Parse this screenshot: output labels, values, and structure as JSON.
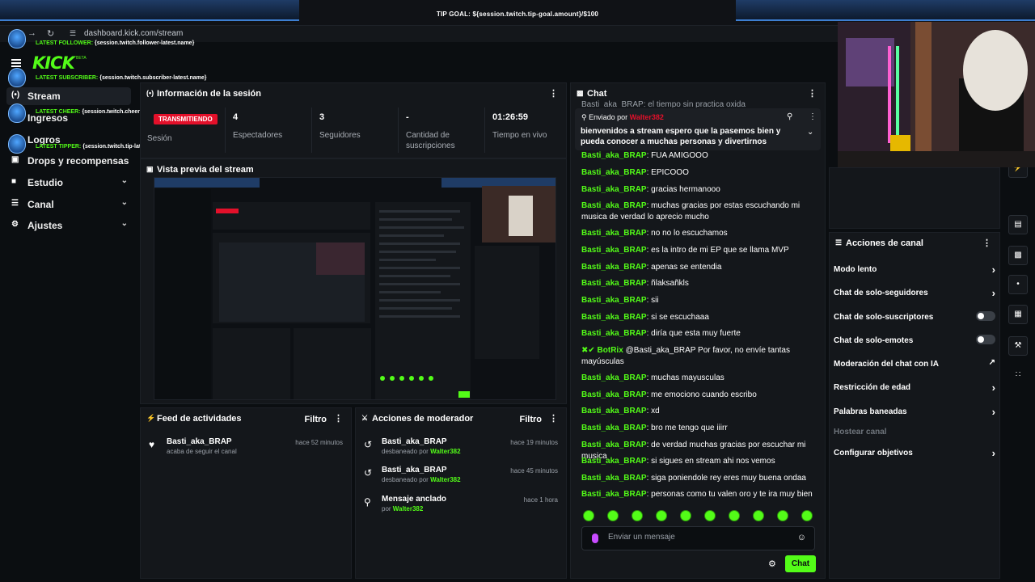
{
  "overlay": {
    "tip_goal": "TIP GOAL: ${session.twitch.tip-goal.amount}/$100",
    "latest_follower_label": "LATEST FOLLOWER:",
    "latest_follower_value": "{session.twitch.follower-latest.name}",
    "latest_subscriber_label": "LATEST SUBSCRIBER:",
    "latest_subscriber_value": "{session.twitch.subscriber-latest.name}",
    "latest_cheer_label": "LATEST CHEER:",
    "latest_cheer_value": "{session.twitch.cheer-latest.name} - {session.twitch.cheer-latest.amount}",
    "latest_tipper_label": "LATEST TIPPER:",
    "latest_tipper_value": "{session.twitch.tip-latest.name} - {session.twitch.tip-latest.amount}"
  },
  "browser": {
    "url": "dashboard.kick.com/stream",
    "back_icon": "arrow-left-icon",
    "forward_icon": "arrow-right-icon",
    "reload_icon": "reload-icon"
  },
  "sidebar": {
    "logo": "KICK",
    "beta": "BETA",
    "items": [
      {
        "label": "Stream",
        "icon": "broadcast-icon",
        "active": true
      },
      {
        "label": "Ingresos",
        "icon": "money-icon"
      },
      {
        "label": "Logros",
        "icon": "trophy-icon"
      },
      {
        "label": "Drops y recompensas",
        "icon": "gift-icon"
      },
      {
        "label": "Estudio",
        "icon": "studio-icon",
        "expandable": true
      },
      {
        "label": "Canal",
        "icon": "channel-icon",
        "expandable": true
      },
      {
        "label": "Ajustes",
        "icon": "gear-icon",
        "expandable": true
      }
    ]
  },
  "session": {
    "title": "Información de la sesión",
    "live_badge": "TRANSMITIENDO",
    "stats": [
      {
        "value": "",
        "label": "Sesión"
      },
      {
        "value": "4",
        "label": "Espectadores"
      },
      {
        "value": "3",
        "label": "Seguidores"
      },
      {
        "value": "-",
        "label": "Cantidad de suscripciones"
      },
      {
        "value": "01:26:59",
        "label": "Tiempo en vivo"
      }
    ]
  },
  "preview": {
    "title": "Vista previa del stream"
  },
  "activity": {
    "title": "Feed de actividades",
    "filter": "Filtro",
    "items": [
      {
        "user": "Basti_aka_BRAP",
        "text": "acaba de seguir el canal",
        "time": "hace 52 minutos"
      }
    ]
  },
  "mod_actions": {
    "title": "Acciones de moderador",
    "filter": "Filtro",
    "items": [
      {
        "title": "Basti_aka_BRAP",
        "text": "desbaneado por",
        "by": "Walter382",
        "time": "hace 19 minutos",
        "icon": "undo-icon"
      },
      {
        "title": "Basti_aka_BRAP",
        "text": "desbaneado por",
        "by": "Walter382",
        "time": "hace 45 minutos",
        "icon": "undo-icon"
      },
      {
        "title": "Mensaje anclado",
        "text": "por",
        "by": "Walter382",
        "time": "hace 1 hora",
        "icon": "pin-icon"
      }
    ]
  },
  "chat": {
    "title": "Chat",
    "partial_top": "Basti_aka_BRAP: el tiempo sin practica oxida",
    "pinned": {
      "sent_by_label": "Enviado por",
      "user": "Walter382",
      "text": "bienvenidos a stream espero que la pasemos bien y pueda conocer a muchas personas y divertirnos"
    },
    "messages": [
      {
        "user": "Basti_aka_BRAP",
        "text": "FUA AMIGOOO"
      },
      {
        "user": "Basti_aka_BRAP",
        "text": "EPICOOO"
      },
      {
        "user": "Basti_aka_BRAP",
        "text": "gracias hermanooo"
      },
      {
        "user": "Basti_aka_BRAP",
        "text": "muchas gracias por estas escuchando mi musica de verdad lo aprecio mucho"
      },
      {
        "user": "Basti_aka_BRAP",
        "text": "no no lo escuchamos"
      },
      {
        "user": "Basti_aka_BRAP",
        "text": "es la intro de mi EP que se llama MVP"
      },
      {
        "user": "Basti_aka_BRAP",
        "text": "apenas se entendia"
      },
      {
        "user": "Basti_aka_BRAP",
        "text": "ñlaksañkls"
      },
      {
        "user": "Basti_aka_BRAP",
        "text": "sii"
      },
      {
        "user": "Basti_aka_BRAP",
        "text": "si se escuchaaa"
      },
      {
        "user": "Basti_aka_BRAP",
        "text": "diría que esta muy fuerte"
      },
      {
        "user": "BotRix",
        "text": "@Basti_aka_BRAP Por favor, no envíe tantas mayúsculas",
        "bot": true
      },
      {
        "user": "Basti_aka_BRAP",
        "text": "muchas mayusculas"
      },
      {
        "user": "Basti_aka_BRAP",
        "text": "me emociono cuando escribo"
      },
      {
        "user": "Basti_aka_BRAP",
        "text": "xd"
      },
      {
        "user": "Basti_aka_BRAP",
        "text": "bro me tengo que iiirr"
      },
      {
        "user": "Basti_aka_BRAP",
        "text": "de verdad muchas gracias por escuchar mi musica"
      },
      {
        "user": "Basti_aka_BRAP",
        "text": "si sigues en stream ahi nos vemos"
      },
      {
        "user": "Basti_aka_BRAP",
        "text": "siga poniendole rey eres muy buena ondaa"
      },
      {
        "user": "Basti_aka_BRAP",
        "text": "personas como tu valen oro y te ira muy bien"
      }
    ],
    "input_placeholder": "Enviar un mensaje",
    "send_label": "Chat"
  },
  "channel_actions": {
    "title": "Acciones de canal",
    "items": [
      {
        "label": "Modo lento",
        "control": "arrow"
      },
      {
        "label": "Chat de solo-seguidores",
        "control": "arrow"
      },
      {
        "label": "Chat de solo-suscriptores",
        "control": "toggle"
      },
      {
        "label": "Chat de solo-emotes",
        "control": "toggle"
      },
      {
        "label": "Moderación del chat con IA",
        "control": "external"
      },
      {
        "label": "Restricción de edad",
        "control": "arrow"
      },
      {
        "label": "Palabras baneadas",
        "control": "arrow"
      },
      {
        "label": "Hostear canal",
        "control": "none",
        "disabled": true
      },
      {
        "label": "Configurar objetivos",
        "control": "arrow"
      }
    ]
  },
  "colors": {
    "accent": "#53fc18",
    "live": "#e3102a",
    "panel": "#14171b",
    "bg": "#0b0e11"
  }
}
